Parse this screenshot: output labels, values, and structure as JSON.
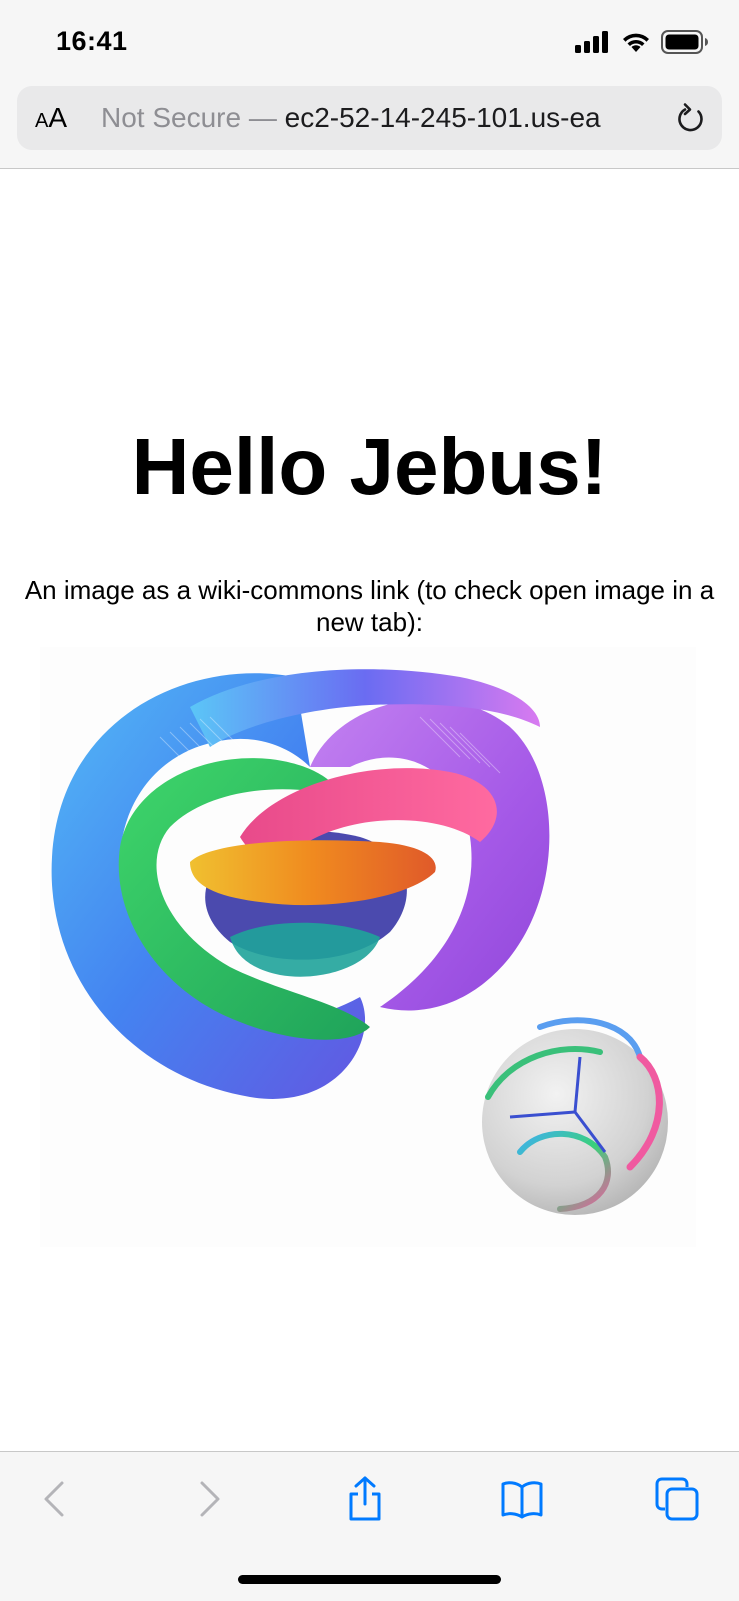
{
  "status_bar": {
    "time": "16:41",
    "icons": [
      "cellular-signal-icon",
      "wifi-icon",
      "battery-icon"
    ]
  },
  "url_bar": {
    "text_size_button": "AA",
    "security_label": "Not Secure —",
    "domain": "ec2-52-14-245-101.us-ea",
    "reload_icon": "reload-icon"
  },
  "page": {
    "title": "Hello Jebus!",
    "description": "An image as a wiki-commons link (to check open image in a new tab):",
    "image_description_icon": "hopf-fibration-image"
  },
  "toolbar": {
    "icons": [
      "back-icon",
      "forward-icon",
      "share-icon",
      "bookmarks-icon",
      "tabs-icon"
    ]
  },
  "colors": {
    "accent": "#007aff",
    "disabled": "#b4b4b8",
    "bar_background": "#f6f6f6",
    "url_field": "#e9e9ea"
  }
}
